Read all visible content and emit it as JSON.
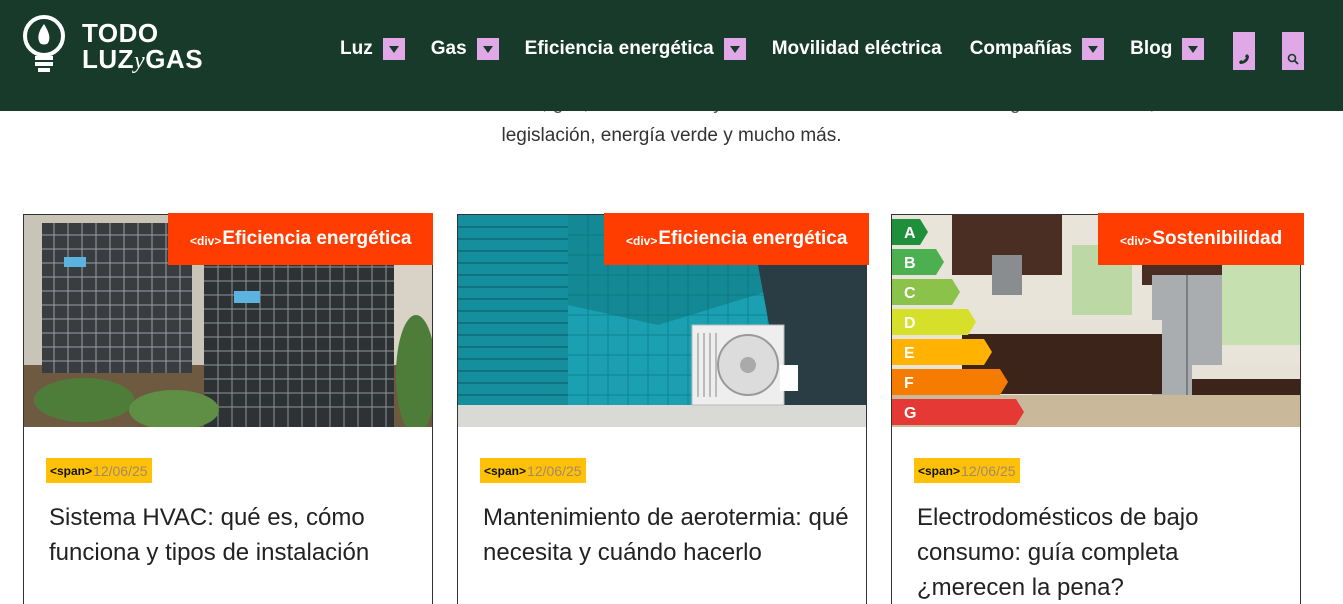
{
  "brand": {
    "line1": "TODO",
    "line2_a": "LUZ",
    "line2_y": "y",
    "line2_b": "GAS"
  },
  "nav": {
    "items": [
      {
        "label": "Luz",
        "has_dropdown": true
      },
      {
        "label": "Gas",
        "has_dropdown": true
      },
      {
        "label": "Eficiencia energética",
        "has_dropdown": true
      },
      {
        "label": "Movilidad eléctrica",
        "has_dropdown": false
      },
      {
        "label": "Compañías",
        "has_dropdown": true
      },
      {
        "label": "Blog",
        "has_dropdown": true
      }
    ],
    "phone_icon": "phone-icon",
    "search_icon": "search-icon"
  },
  "intro": {
    "line1": "Entérate de todas las novedades relacionadas con luz, gas, autoconsumo y movilidad eléctrica en nuestro blog: nuevas tarifas, cambios de",
    "line2": "legislación, energía verde y mucho más."
  },
  "cards": [
    {
      "tag_prefix": "<div>",
      "tag": "Eficiencia energética",
      "date_prefix": "<span>",
      "date": "12/06/25",
      "title": "Sistema HVAC: qué es, cómo funciona y tipos de instalación"
    },
    {
      "tag_prefix": "<div>",
      "tag": "Eficiencia energética",
      "date_prefix": "<span>",
      "date": "12/06/25",
      "title": "Mantenimiento de aerotermia: qué necesita y cuándo hacerlo"
    },
    {
      "tag_prefix": "<div>",
      "tag": "Sostenibilidad",
      "date_prefix": "<span>",
      "date": "12/06/25",
      "title": "Electrodomésticos de bajo consumo: guía completa ¿merecen la pena?"
    }
  ],
  "energy_labels": [
    "A",
    "B",
    "C",
    "D",
    "E",
    "F",
    "G"
  ],
  "colors": {
    "header_bg": "#173a2b",
    "accent_tag": "#ff3d00",
    "date_badge": "#ffc107",
    "dropdown_button": "#e0a8e6"
  }
}
